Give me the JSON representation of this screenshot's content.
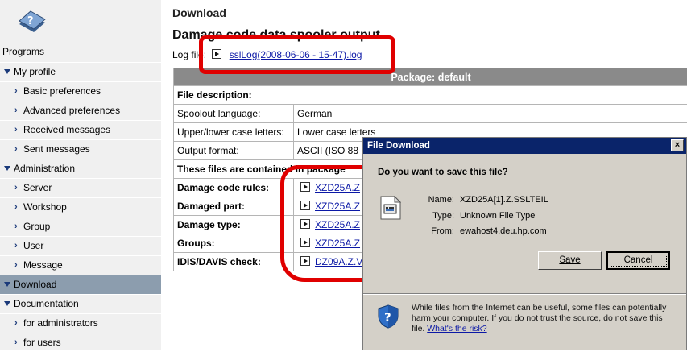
{
  "sidebar": {
    "programs_label": "Programs",
    "items": [
      {
        "label": "My profile",
        "level": 1
      },
      {
        "label": "Basic preferences",
        "level": 2
      },
      {
        "label": "Advanced preferences",
        "level": 2
      },
      {
        "label": "Received messages",
        "level": 2
      },
      {
        "label": "Sent messages",
        "level": 2
      },
      {
        "label": "Administration",
        "level": 1
      },
      {
        "label": "Server",
        "level": 2
      },
      {
        "label": "Workshop",
        "level": 2
      },
      {
        "label": "Group",
        "level": 2
      },
      {
        "label": "User",
        "level": 2
      },
      {
        "label": "Message",
        "level": 2
      },
      {
        "label": "Download",
        "level": 1,
        "active": true
      },
      {
        "label": "Documentation",
        "level": 1
      },
      {
        "label": "for administrators",
        "level": 2
      },
      {
        "label": "for users",
        "level": 2
      }
    ]
  },
  "main": {
    "breadcrumb": "Download",
    "title": "Damage code data spooler output",
    "log_label": "Log file:",
    "log_link": "sslLog(2008-06-06 - 15-47).log",
    "package_header": "Package: default",
    "file_description": "File description:",
    "rows": [
      {
        "k": "Spoolout language:",
        "v": "German"
      },
      {
        "k": "Upper/lower case letters:",
        "v": "Lower case letters"
      },
      {
        "k": "Output format:",
        "v": "ASCII (ISO 88"
      }
    ],
    "contained_label": "These files are contained in package",
    "files": [
      {
        "k": "Damage code rules:",
        "v": "XZD25A.Z"
      },
      {
        "k": "Damaged part:",
        "v": "XZD25A.Z"
      },
      {
        "k": "Damage type:",
        "v": "XZD25A.Z"
      },
      {
        "k": "Groups:",
        "v": "XZD25A.Z"
      },
      {
        "k": "IDIS/DAVIS check:",
        "v": "DZ09A.Z.V"
      }
    ]
  },
  "dialog": {
    "title": "File Download",
    "question": "Do you want to save this file?",
    "name_label": "Name:",
    "name_value": "XZD25A[1].Z.SSLTEIL",
    "type_label": "Type:",
    "type_value": "Unknown File Type",
    "from_label": "From:",
    "from_value": "ewahost4.deu.hp.com",
    "save_label": "Save",
    "cancel_label": "Cancel",
    "note": "While files from the Internet can be useful, some files can potentially harm your computer. If you do not trust the source, do not save this file.",
    "risk_link": "What's the risk?",
    "close_glyph": "×"
  },
  "colors": {
    "sidebar_bg": "#f0f0f0",
    "active_item": "#8c9dae",
    "table_header": "#8a8a8a",
    "link": "#0b18a6",
    "highlight": "#e00000",
    "titlebar": "#0a246a"
  }
}
